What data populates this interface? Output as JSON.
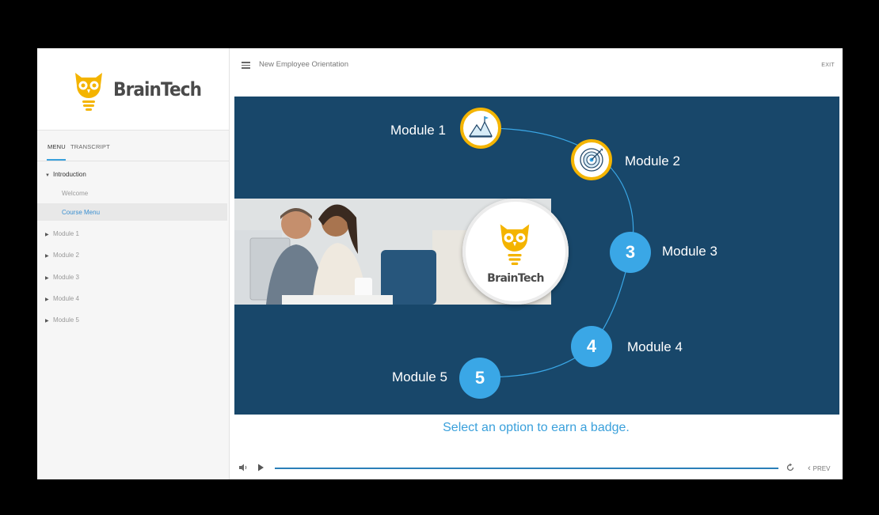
{
  "brand": {
    "name": "BrainTech",
    "color": "#f4b400"
  },
  "sidebar": {
    "tabs": {
      "menu": "MENU",
      "transcript": "TRANSCRIPT"
    },
    "intro": "Introduction",
    "intro_items": [
      "Welcome",
      "Course Menu"
    ],
    "modules": [
      "Module 1",
      "Module 2",
      "Module 3",
      "Module 4",
      "Module 5"
    ]
  },
  "header": {
    "title": "New Employee Orientation",
    "exit": "EXIT"
  },
  "stage": {
    "modules": [
      {
        "label": "Module 1",
        "icon": "mountain-flag-icon"
      },
      {
        "label": "Module 2",
        "icon": "target-icon"
      },
      {
        "label": "Module 3",
        "number": "3"
      },
      {
        "label": "Module 4",
        "number": "4"
      },
      {
        "label": "Module 5",
        "number": "5"
      }
    ],
    "badge_text": "BrainTech",
    "prompt": "Select an option to earn a badge."
  },
  "controls": {
    "prev": "PREV"
  },
  "colors": {
    "stage_bg": "#18476a",
    "accent": "#3aa7e6",
    "gold": "#f4b400"
  }
}
